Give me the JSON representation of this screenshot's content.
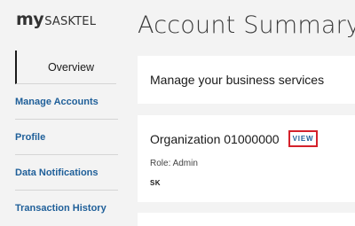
{
  "logo": {
    "my": "my",
    "brand": "SASKTEL"
  },
  "page": {
    "title": "Account Summary"
  },
  "sidebar": {
    "items": [
      {
        "label": "Overview",
        "active": true
      },
      {
        "label": "Manage Accounts",
        "active": false
      },
      {
        "label": "Profile",
        "active": false
      },
      {
        "label": "Data Notifications",
        "active": false
      },
      {
        "label": "Transaction History",
        "active": false
      }
    ]
  },
  "services_card": {
    "heading": "Manage your business services"
  },
  "organization_card": {
    "name": "Organization 01000000",
    "view_label": "VIEW",
    "role": "Role: Admin",
    "region": "SK"
  },
  "colors": {
    "link": "#1f5f99",
    "highlight_border": "#d4212b",
    "background": "#f3f3f3",
    "card": "#ffffff"
  }
}
